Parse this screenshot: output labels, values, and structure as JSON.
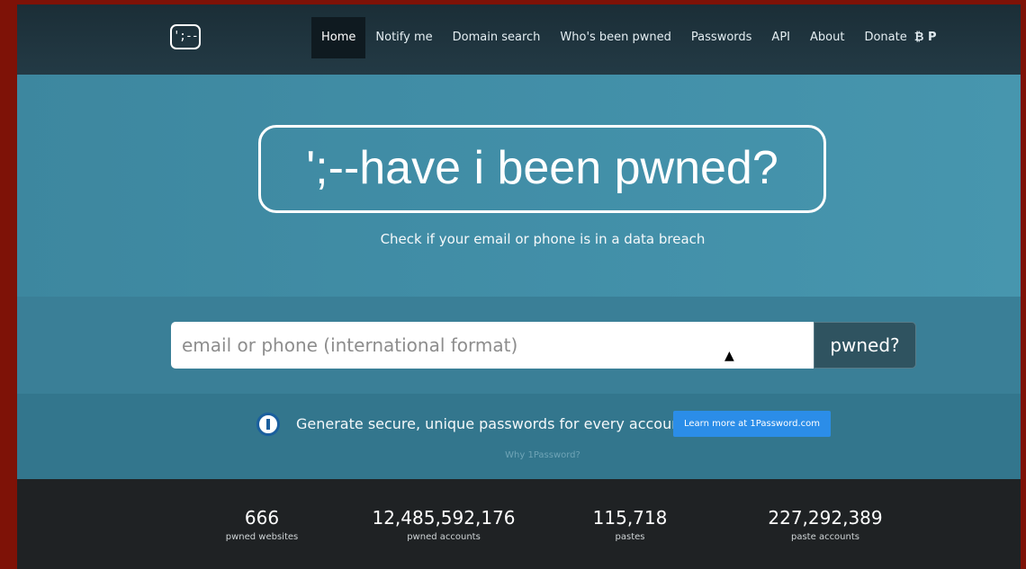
{
  "nav": {
    "logo_text": "';--",
    "items": [
      {
        "label": "Home",
        "active": true
      },
      {
        "label": "Notify me"
      },
      {
        "label": "Domain search"
      },
      {
        "label": "Who's been pwned"
      },
      {
        "label": "Passwords"
      },
      {
        "label": "API"
      },
      {
        "label": "About"
      },
      {
        "label": "Donate"
      }
    ],
    "donate_icons": "₿ P"
  },
  "hero": {
    "title": "';--have i been pwned?",
    "subtitle": "Check if your email or phone is in a data breach"
  },
  "search": {
    "placeholder": "email or phone (international format)",
    "button": "pwned?"
  },
  "promo": {
    "text": "Generate secure, unique passwords for every account",
    "button": "Learn more at 1Password.com",
    "why": "Why 1Password?"
  },
  "stats": [
    {
      "value": "666",
      "label": "pwned websites"
    },
    {
      "value": "12,485,592,176",
      "label": "pwned accounts"
    },
    {
      "value": "115,718",
      "label": "pastes"
    },
    {
      "value": "227,292,389",
      "label": "paste accounts"
    }
  ],
  "colors": {
    "nav_bg": "#1b2e37",
    "hero_bg": "#428fa8",
    "accent_button": "#2b8de8",
    "stats_bg": "#1f2224"
  }
}
